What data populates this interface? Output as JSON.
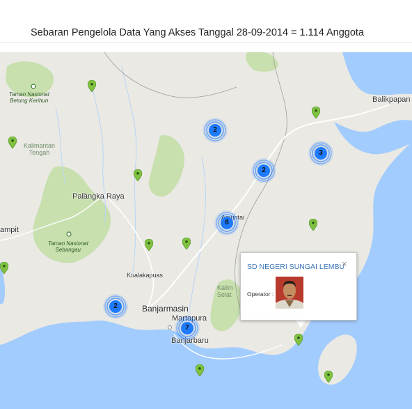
{
  "header": {
    "title": "Sebaran Pengelola Data Yang Akses Tanggal 28-09-2014 = 1.114 Anggota"
  },
  "map": {
    "colors": {
      "land": "#eae9e4",
      "sea": "#a3ccfe",
      "park": "#c8dfae",
      "road": "#ffffff",
      "cluster": "#1e7bff",
      "pin": "#7fc241",
      "popup_title": "#3a73b8"
    },
    "labels": {
      "balikpapan": "Balikpapan",
      "kalimantan_tengah": [
        "Kalimantan",
        "Tengah"
      ],
      "palangka_raya": "Palangka Raya",
      "sampit": "ampit",
      "kualakapuas": "Kualakapuas",
      "banjarmasin": "Banjarmasin",
      "martapura": "Martapura",
      "banjarbaru": "Banjarbaru",
      "amuntai": "Amuntai",
      "kalimantan_selatan": [
        "Kalim",
        "Selat"
      ],
      "tn_betung": [
        "Taman Nasional",
        "Betung Kerihun"
      ],
      "tn_sebangau": [
        "Taman Nasional",
        "Sebangau"
      ]
    },
    "clusters": [
      {
        "id": "c1",
        "count": "2"
      },
      {
        "id": "c2",
        "count": "2"
      },
      {
        "id": "c3",
        "count": "3"
      },
      {
        "id": "c4",
        "count": "8"
      },
      {
        "id": "c5",
        "count": "2"
      },
      {
        "id": "c6",
        "count": "7"
      }
    ],
    "popup": {
      "title": "SD NEGERI SUNGAI LEMBU",
      "operator_label": "Operator :",
      "close": "×"
    }
  }
}
